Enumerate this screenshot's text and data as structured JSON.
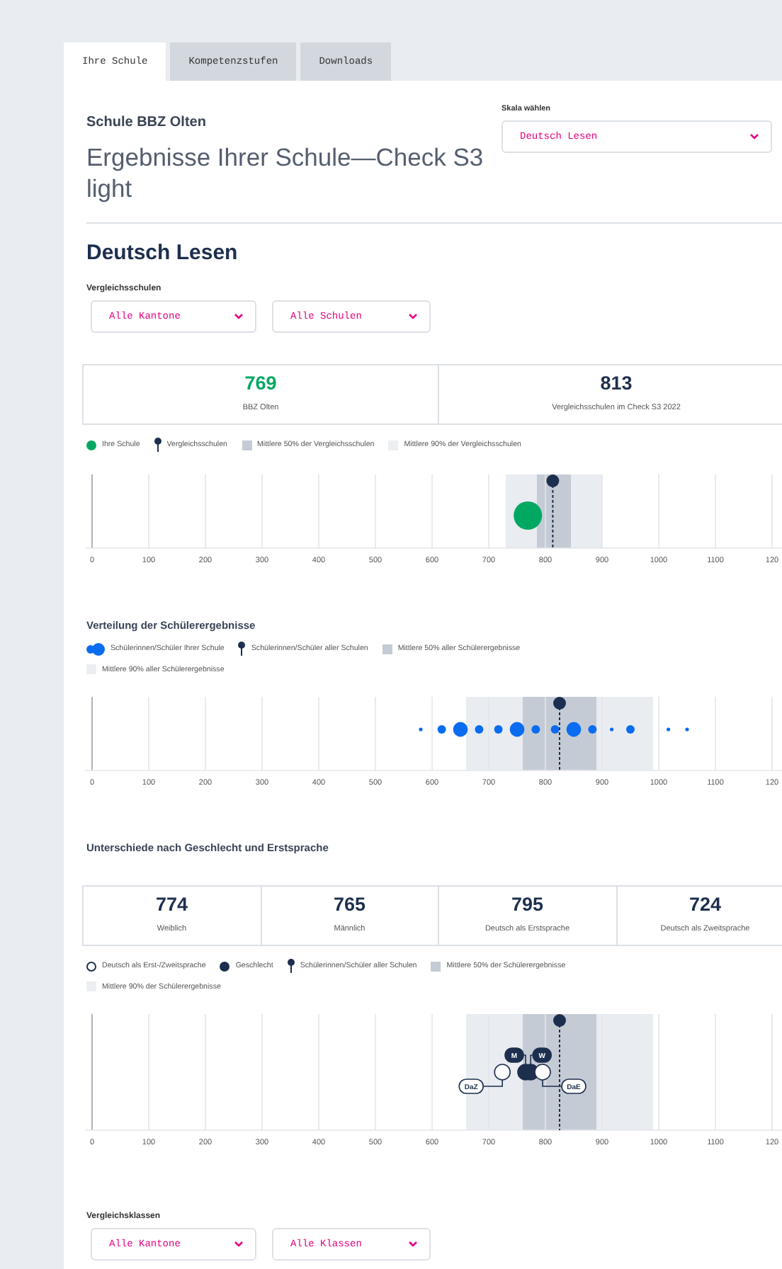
{
  "tabs": [
    {
      "label": "Ihre Schule",
      "selected": true
    },
    {
      "label": "Kompetenzstufen",
      "selected": false
    },
    {
      "label": "Downloads",
      "selected": false
    }
  ],
  "school": "Schule BBZ Olten",
  "title": "Ergebnisse Ihrer Schule—Check S3 light",
  "scale_select": {
    "label": "Skala wählen",
    "value": "Deutsch Lesen"
  },
  "section_title": "Deutsch Lesen",
  "comparison_schools": {
    "label": "Vergleichsschulen",
    "dropdowns": [
      "Alle Kantone",
      "Alle Schulen"
    ]
  },
  "overview": {
    "scores": [
      {
        "value": "769",
        "label": "BBZ Olten",
        "color": "#00a862"
      },
      {
        "value": "813",
        "label": "Vergleichsschulen im Check S3 2022",
        "color": "#1d2f4e"
      }
    ],
    "legend": [
      {
        "kind": "dot",
        "label": "Ihre Schule"
      },
      {
        "kind": "pin",
        "label": "Vergleichsschulen"
      },
      {
        "kind": "band50",
        "label": "Mittlere 50% der Vergleichsschulen"
      },
      {
        "kind": "band90",
        "label": "Mittlere 90% der Vergleichsschulen"
      }
    ],
    "axis_ticks": [
      "0",
      "100",
      "200",
      "300",
      "400",
      "500",
      "600",
      "700",
      "800",
      "900",
      "1000",
      "1100",
      "120"
    ]
  },
  "distribution": {
    "title": "Verteilung der Schülerergebnisse",
    "legend": [
      {
        "kind": "dots",
        "label": "Schülerinnen/Schüler Ihrer Schule"
      },
      {
        "kind": "pin",
        "label": "Schülerinnen/Schüler aller Schulen"
      },
      {
        "kind": "band50",
        "label": "Mittlere 50% aller Schülerergebnisse"
      },
      {
        "kind": "band90",
        "label": "Mittlere 90% aller Schülerergebnisse"
      }
    ],
    "axis_ticks": [
      "0",
      "100",
      "200",
      "300",
      "400",
      "500",
      "600",
      "700",
      "800",
      "900",
      "1000",
      "1100",
      "120"
    ]
  },
  "differences": {
    "title": "Unterschiede nach Geschlecht und Erstsprache",
    "scores": [
      {
        "value": "774",
        "label": "Weiblich"
      },
      {
        "value": "765",
        "label": "Männlich"
      },
      {
        "value": "795",
        "label": "Deutsch als Erstsprache"
      },
      {
        "value": "724",
        "label": "Deutsch als Zweitsprache"
      }
    ],
    "legend": [
      {
        "kind": "ring",
        "label": "Deutsch als Erst-/Zweitsprache"
      },
      {
        "kind": "disc",
        "label": "Geschlecht"
      },
      {
        "kind": "pin",
        "label": "Schülerinnen/Schüler aller Schulen"
      },
      {
        "kind": "band50",
        "label": "Mittlere 50% der Schülerergebnisse"
      },
      {
        "kind": "band90",
        "label": "Mittlere 90% der Schülerergebnisse"
      }
    ],
    "tags": [
      {
        "kind": "disc",
        "label": "M"
      },
      {
        "kind": "disc",
        "label": "W"
      },
      {
        "kind": "ring",
        "label": "DaZ"
      },
      {
        "kind": "ring",
        "label": "DaE"
      }
    ],
    "axis_ticks": [
      "0",
      "100",
      "200",
      "300",
      "400",
      "500",
      "600",
      "700",
      "800",
      "900",
      "1000",
      "1100",
      "120"
    ]
  },
  "comparison_classes": {
    "label": "Vergleichsklassen",
    "dropdowns": [
      "Alle Kantone",
      "Alle Klassen"
    ]
  }
}
